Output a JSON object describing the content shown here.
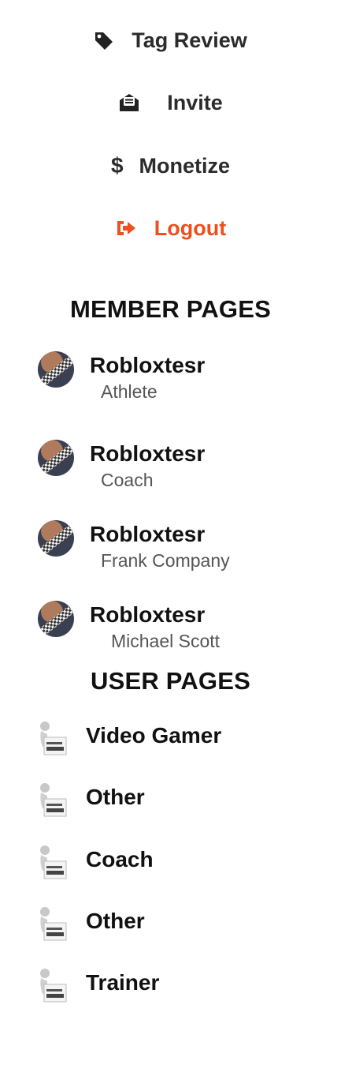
{
  "menu": {
    "tag_review": "Tag Review",
    "invite": "Invite",
    "monetize": "Monetize",
    "monetize_symbol": "$",
    "logout": "Logout"
  },
  "icons": {
    "tag_review": "tag-icon",
    "invite": "envelope-open-icon",
    "logout": "sign-out-icon",
    "accent_color": "#ef4e1d"
  },
  "member_pages": {
    "title": "MEMBER PAGES",
    "items": [
      {
        "name": "Robloxtesr",
        "role": "Athlete"
      },
      {
        "name": "Robloxtesr",
        "role": "Coach"
      },
      {
        "name": "Robloxtesr",
        "role": "Frank Company"
      },
      {
        "name": "Robloxtesr",
        "role": "Michael Scott"
      }
    ]
  },
  "user_pages": {
    "title": "USER PAGES",
    "items": [
      {
        "label": "Video Gamer"
      },
      {
        "label": "Other"
      },
      {
        "label": "Coach"
      },
      {
        "label": "Other"
      },
      {
        "label": "Trainer"
      }
    ]
  }
}
